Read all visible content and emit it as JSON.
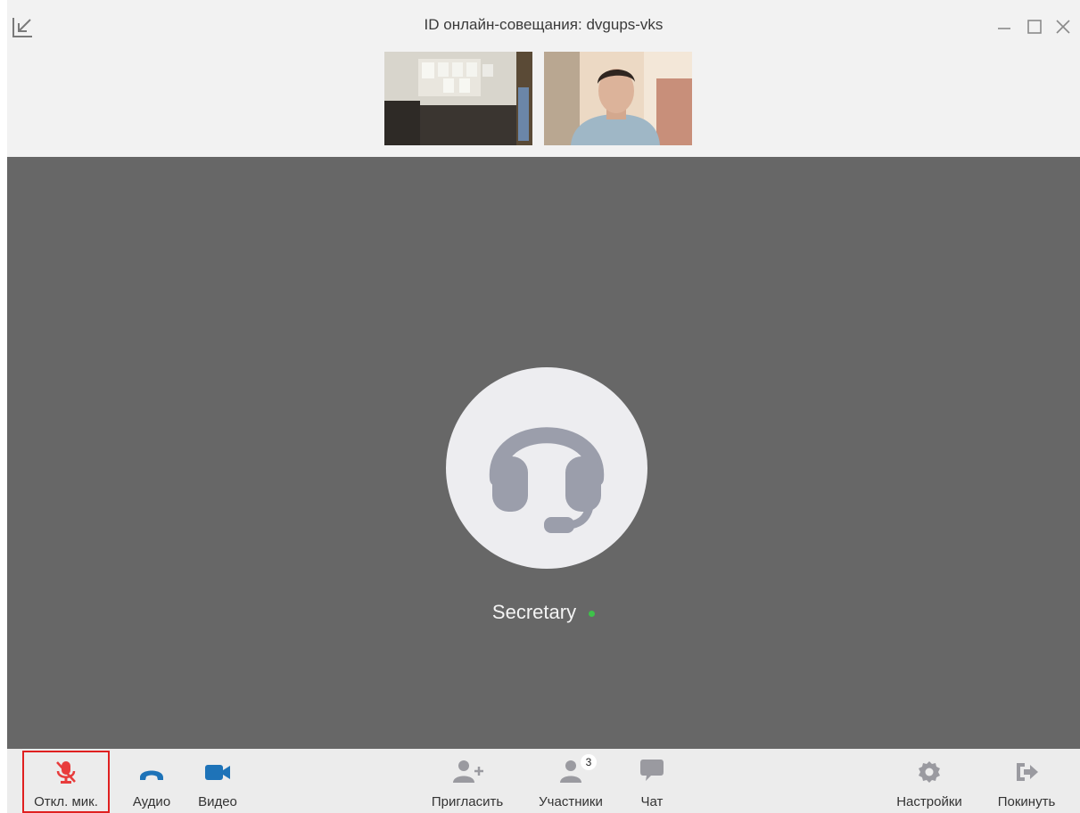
{
  "window": {
    "title": "ID онлайн-совещания: dvgups-vks"
  },
  "stage": {
    "participant_name": "Secretary",
    "status_color": "#3ec24a"
  },
  "toolbar": {
    "mute_label": "Откл. мик.",
    "audio_label": "Аудио",
    "video_label": "Видео",
    "invite_label": "Пригласить",
    "participants_label": "Участники",
    "participants_count": "3",
    "chat_label": "Чат",
    "settings_label": "Настройки",
    "leave_label": "Покинуть"
  },
  "colors": {
    "accent_blue": "#1e73b8",
    "mute_red": "#e83c3c",
    "icon_gray": "#9a9aa0",
    "stage_bg": "#676767"
  },
  "icons": {
    "collapse": "collapse-arrow-icon",
    "mute": "microphone-off-icon",
    "audio": "phone-icon",
    "video": "camera-icon",
    "invite": "add-user-icon",
    "participants": "user-icon",
    "chat": "chat-bubble-icon",
    "settings": "gear-icon",
    "leave": "exit-icon",
    "avatar": "headset-icon"
  }
}
